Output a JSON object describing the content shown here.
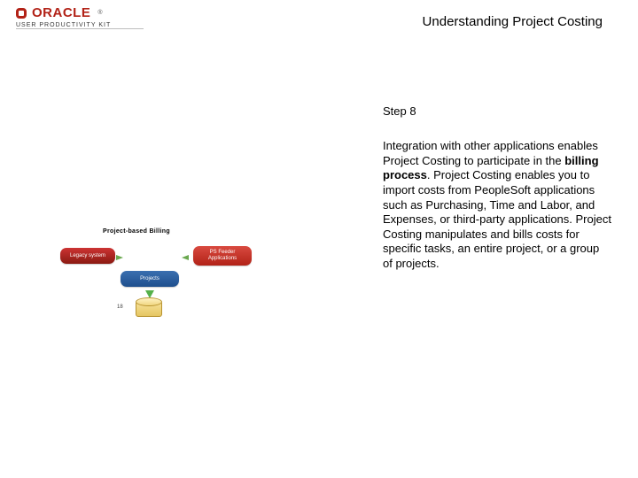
{
  "brand": {
    "logo_text": "ORACLE",
    "tm": "®",
    "subline": "USER PRODUCTIVITY KIT"
  },
  "page_title": "Understanding Project Costing",
  "step_label": "Step 8",
  "body": {
    "t1": "Integration with other applications enables Project Costing to participate in the ",
    "bold": "billing process",
    "t2": ". Project Costing enables you to import costs from PeopleSoft applications such as Purchasing, Time and Labor, and Expenses, or third-party applications. Project Costing manipulates and bills costs for specific tasks, an entire project, or a group of projects."
  },
  "diagram": {
    "title": "Project-based Billing",
    "legacy": "Legacy system",
    "feeder": "PS Feeder Applications",
    "projects": "Projects",
    "db": "18"
  }
}
